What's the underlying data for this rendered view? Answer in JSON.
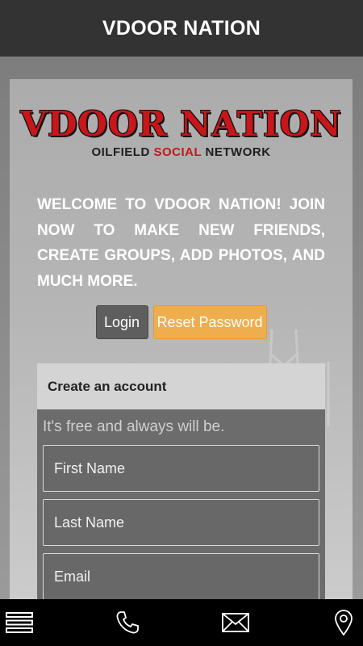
{
  "header": {
    "title": "VDOOR NATION"
  },
  "logo": {
    "title": "VDOOR NATION",
    "subtitle_part1": "OILFIELD",
    "subtitle_part2": "SOCIAL",
    "subtitle_part3": "NETWORK"
  },
  "welcome_text": "Welcome to VDOOR NATION! Join now to make new friends, create groups, add photos, and much more.",
  "buttons": {
    "login": "Login",
    "reset": "Reset Password"
  },
  "account": {
    "heading": "Create an account",
    "tagline": "It's free and always will be.",
    "fields": {
      "first_name": "First Name",
      "last_name": "Last Name",
      "email": "Email"
    }
  },
  "bottom_nav": {
    "icons": [
      "menu-icon",
      "phone-icon",
      "mail-icon",
      "location-pin-icon"
    ]
  },
  "colors": {
    "header_bg": "#333333",
    "reset_button": "#f0ad4e",
    "login_button": "#5e5e5e",
    "logo_red": "#c8161a",
    "bottom_bar": "#000000"
  }
}
